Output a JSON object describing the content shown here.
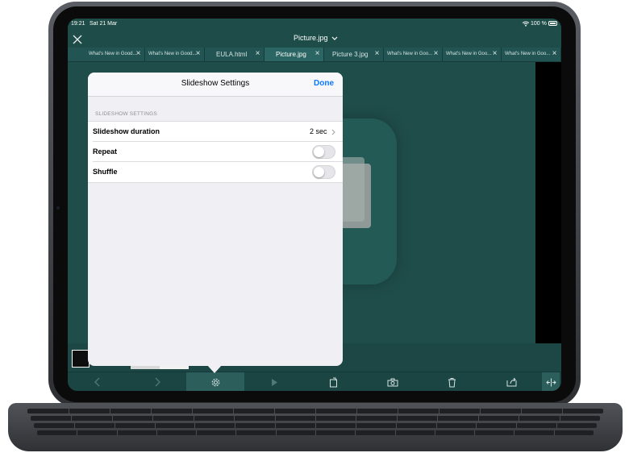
{
  "status_bar": {
    "time": "19:21",
    "date": "Sat 21 Mar",
    "battery": "100 %"
  },
  "titlebar": {
    "title": "Picture.jpg"
  },
  "tabs": [
    {
      "label": "What's New in Good..."
    },
    {
      "label": "What's New in Good..."
    },
    {
      "label": "EULA.html"
    },
    {
      "label": "Picture.jpg",
      "active": true
    },
    {
      "label": "Picture 3.jpg"
    },
    {
      "label": "What's New in Goo..."
    },
    {
      "label": "What's New in Goo..."
    },
    {
      "label": "What's New in Goo..."
    }
  ],
  "popover": {
    "title": "Slideshow Settings",
    "done_label": "Done",
    "section_header": "SLIDESHOW SETTINGS",
    "rows": [
      {
        "label": "Slideshow duration",
        "value": "2 sec"
      },
      {
        "label": "Repeat",
        "toggle_on": false
      },
      {
        "label": "Shuffle",
        "toggle_on": false
      }
    ]
  },
  "icons": {
    "close": "close-icon",
    "chevron": "chevron-down-icon",
    "back": "chevron-left-icon",
    "forward": "chevron-right-icon",
    "settings": "gear-icon",
    "play": "play-icon",
    "rotate": "rotate-icon",
    "camera": "camera-icon",
    "trash": "trash-icon",
    "share": "share-icon",
    "fullscreen": "expand-horizontal-icon"
  },
  "colors": {
    "accent": "#0a7aff",
    "theme": "#1e4d49"
  }
}
